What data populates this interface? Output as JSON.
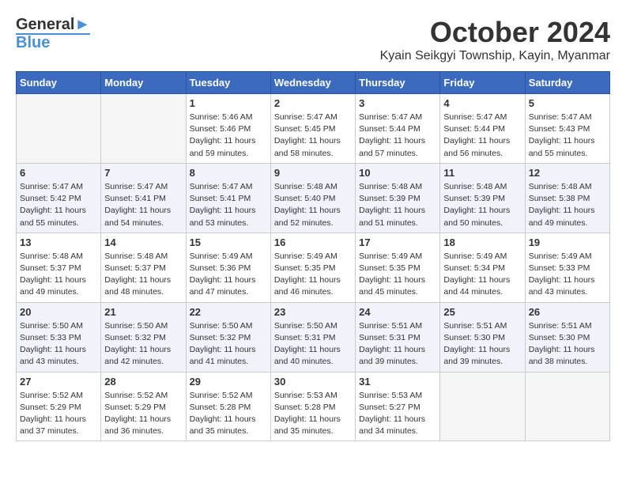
{
  "header": {
    "logo_line1": "General",
    "logo_line2": "Blue",
    "month": "October 2024",
    "location": "Kyain Seikgyi Township, Kayin, Myanmar"
  },
  "weekdays": [
    "Sunday",
    "Monday",
    "Tuesday",
    "Wednesday",
    "Thursday",
    "Friday",
    "Saturday"
  ],
  "weeks": [
    [
      {
        "day": "",
        "sunrise": "",
        "sunset": "",
        "daylight": ""
      },
      {
        "day": "",
        "sunrise": "",
        "sunset": "",
        "daylight": ""
      },
      {
        "day": "1",
        "sunrise": "Sunrise: 5:46 AM",
        "sunset": "Sunset: 5:46 PM",
        "daylight": "Daylight: 11 hours and 59 minutes."
      },
      {
        "day": "2",
        "sunrise": "Sunrise: 5:47 AM",
        "sunset": "Sunset: 5:45 PM",
        "daylight": "Daylight: 11 hours and 58 minutes."
      },
      {
        "day": "3",
        "sunrise": "Sunrise: 5:47 AM",
        "sunset": "Sunset: 5:44 PM",
        "daylight": "Daylight: 11 hours and 57 minutes."
      },
      {
        "day": "4",
        "sunrise": "Sunrise: 5:47 AM",
        "sunset": "Sunset: 5:44 PM",
        "daylight": "Daylight: 11 hours and 56 minutes."
      },
      {
        "day": "5",
        "sunrise": "Sunrise: 5:47 AM",
        "sunset": "Sunset: 5:43 PM",
        "daylight": "Daylight: 11 hours and 55 minutes."
      }
    ],
    [
      {
        "day": "6",
        "sunrise": "Sunrise: 5:47 AM",
        "sunset": "Sunset: 5:42 PM",
        "daylight": "Daylight: 11 hours and 55 minutes."
      },
      {
        "day": "7",
        "sunrise": "Sunrise: 5:47 AM",
        "sunset": "Sunset: 5:41 PM",
        "daylight": "Daylight: 11 hours and 54 minutes."
      },
      {
        "day": "8",
        "sunrise": "Sunrise: 5:47 AM",
        "sunset": "Sunset: 5:41 PM",
        "daylight": "Daylight: 11 hours and 53 minutes."
      },
      {
        "day": "9",
        "sunrise": "Sunrise: 5:48 AM",
        "sunset": "Sunset: 5:40 PM",
        "daylight": "Daylight: 11 hours and 52 minutes."
      },
      {
        "day": "10",
        "sunrise": "Sunrise: 5:48 AM",
        "sunset": "Sunset: 5:39 PM",
        "daylight": "Daylight: 11 hours and 51 minutes."
      },
      {
        "day": "11",
        "sunrise": "Sunrise: 5:48 AM",
        "sunset": "Sunset: 5:39 PM",
        "daylight": "Daylight: 11 hours and 50 minutes."
      },
      {
        "day": "12",
        "sunrise": "Sunrise: 5:48 AM",
        "sunset": "Sunset: 5:38 PM",
        "daylight": "Daylight: 11 hours and 49 minutes."
      }
    ],
    [
      {
        "day": "13",
        "sunrise": "Sunrise: 5:48 AM",
        "sunset": "Sunset: 5:37 PM",
        "daylight": "Daylight: 11 hours and 49 minutes."
      },
      {
        "day": "14",
        "sunrise": "Sunrise: 5:48 AM",
        "sunset": "Sunset: 5:37 PM",
        "daylight": "Daylight: 11 hours and 48 minutes."
      },
      {
        "day": "15",
        "sunrise": "Sunrise: 5:49 AM",
        "sunset": "Sunset: 5:36 PM",
        "daylight": "Daylight: 11 hours and 47 minutes."
      },
      {
        "day": "16",
        "sunrise": "Sunrise: 5:49 AM",
        "sunset": "Sunset: 5:35 PM",
        "daylight": "Daylight: 11 hours and 46 minutes."
      },
      {
        "day": "17",
        "sunrise": "Sunrise: 5:49 AM",
        "sunset": "Sunset: 5:35 PM",
        "daylight": "Daylight: 11 hours and 45 minutes."
      },
      {
        "day": "18",
        "sunrise": "Sunrise: 5:49 AM",
        "sunset": "Sunset: 5:34 PM",
        "daylight": "Daylight: 11 hours and 44 minutes."
      },
      {
        "day": "19",
        "sunrise": "Sunrise: 5:49 AM",
        "sunset": "Sunset: 5:33 PM",
        "daylight": "Daylight: 11 hours and 43 minutes."
      }
    ],
    [
      {
        "day": "20",
        "sunrise": "Sunrise: 5:50 AM",
        "sunset": "Sunset: 5:33 PM",
        "daylight": "Daylight: 11 hours and 43 minutes."
      },
      {
        "day": "21",
        "sunrise": "Sunrise: 5:50 AM",
        "sunset": "Sunset: 5:32 PM",
        "daylight": "Daylight: 11 hours and 42 minutes."
      },
      {
        "day": "22",
        "sunrise": "Sunrise: 5:50 AM",
        "sunset": "Sunset: 5:32 PM",
        "daylight": "Daylight: 11 hours and 41 minutes."
      },
      {
        "day": "23",
        "sunrise": "Sunrise: 5:50 AM",
        "sunset": "Sunset: 5:31 PM",
        "daylight": "Daylight: 11 hours and 40 minutes."
      },
      {
        "day": "24",
        "sunrise": "Sunrise: 5:51 AM",
        "sunset": "Sunset: 5:31 PM",
        "daylight": "Daylight: 11 hours and 39 minutes."
      },
      {
        "day": "25",
        "sunrise": "Sunrise: 5:51 AM",
        "sunset": "Sunset: 5:30 PM",
        "daylight": "Daylight: 11 hours and 39 minutes."
      },
      {
        "day": "26",
        "sunrise": "Sunrise: 5:51 AM",
        "sunset": "Sunset: 5:30 PM",
        "daylight": "Daylight: 11 hours and 38 minutes."
      }
    ],
    [
      {
        "day": "27",
        "sunrise": "Sunrise: 5:52 AM",
        "sunset": "Sunset: 5:29 PM",
        "daylight": "Daylight: 11 hours and 37 minutes."
      },
      {
        "day": "28",
        "sunrise": "Sunrise: 5:52 AM",
        "sunset": "Sunset: 5:29 PM",
        "daylight": "Daylight: 11 hours and 36 minutes."
      },
      {
        "day": "29",
        "sunrise": "Sunrise: 5:52 AM",
        "sunset": "Sunset: 5:28 PM",
        "daylight": "Daylight: 11 hours and 35 minutes."
      },
      {
        "day": "30",
        "sunrise": "Sunrise: 5:53 AM",
        "sunset": "Sunset: 5:28 PM",
        "daylight": "Daylight: 11 hours and 35 minutes."
      },
      {
        "day": "31",
        "sunrise": "Sunrise: 5:53 AM",
        "sunset": "Sunset: 5:27 PM",
        "daylight": "Daylight: 11 hours and 34 minutes."
      },
      {
        "day": "",
        "sunrise": "",
        "sunset": "",
        "daylight": ""
      },
      {
        "day": "",
        "sunrise": "",
        "sunset": "",
        "daylight": ""
      }
    ]
  ]
}
